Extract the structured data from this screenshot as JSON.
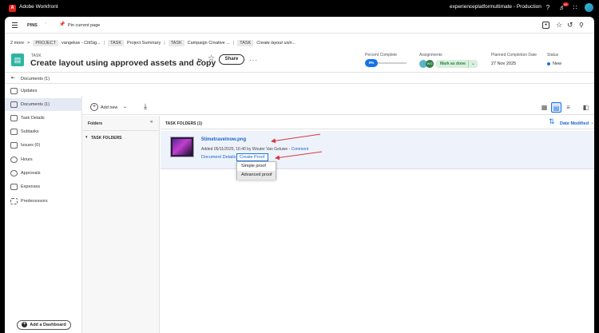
{
  "topbar": {
    "app_title": "Adobe Workfront",
    "logo_letter": "A",
    "org_name": "experienceplatformultimate - Production",
    "notif_badge": "9+"
  },
  "pins": {
    "label": "PINS",
    "pin_current": "Pin current page"
  },
  "breadcrumb": {
    "more": "2 more",
    "sep": ">",
    "items": [
      {
        "tag": "PROJECT",
        "text": "vangeluw - CitiSig..."
      },
      {
        "tag": "TASK",
        "text": "Project Summary"
      },
      {
        "tag": "TASK",
        "text": "Campaign Creative ..."
      },
      {
        "tag": "TASK",
        "text": "Create layout usin..."
      }
    ]
  },
  "header": {
    "type_label": "TASK",
    "title": "Create layout using approved assets and copy",
    "share_label": "Share",
    "percent_label": "Percent Complete",
    "percent_value": "0%",
    "percent_fraction": 0,
    "assignments_label": "Assignments",
    "assignee_initials": "WG",
    "mark_done": "Mark as done",
    "planned_label": "Planned Completion Date",
    "planned_value": "27 Nov 2025",
    "status_label": "Status",
    "status_value": "New"
  },
  "docs_toggle": "Documents (1)",
  "sidebar": {
    "items": [
      {
        "label": "Updates",
        "icon": "chat-icon"
      },
      {
        "label": "Documents (1)",
        "icon": "document-icon"
      },
      {
        "label": "Task Details",
        "icon": "details-icon"
      },
      {
        "label": "Subtasks",
        "icon": "subtasks-icon"
      },
      {
        "label": "Issues (0)",
        "icon": "issues-icon"
      },
      {
        "label": "Hours",
        "icon": "clock-icon"
      },
      {
        "label": "Approvals",
        "icon": "approval-icon"
      },
      {
        "label": "Expenses",
        "icon": "expenses-icon"
      },
      {
        "label": "Predecessors",
        "icon": "predecessors-icon"
      }
    ],
    "add_dashboard": "Add a Dashboard"
  },
  "toolbar": {
    "add_new": "Add new"
  },
  "folders": {
    "title": "Folders",
    "task_folders": "TASK FOLDERS"
  },
  "main": {
    "header": "TASK FOLDERS (1)",
    "sort_label": "Date Modified"
  },
  "document": {
    "name": "5timetravelnow.png",
    "added_meta": "Added 05/11/2025, 16:40 by Wouter Van Geluwe",
    "comment_sep": "-",
    "comment_link": "Comment",
    "details_link": "Document Details",
    "create_proof": "Create Proof"
  },
  "proof_menu": {
    "options": [
      "Simple proof",
      "Advanced proof"
    ]
  },
  "colors": {
    "accent": "#1473e6",
    "annotation_arrow": "#d7373f",
    "brand": "#e3221c"
  }
}
